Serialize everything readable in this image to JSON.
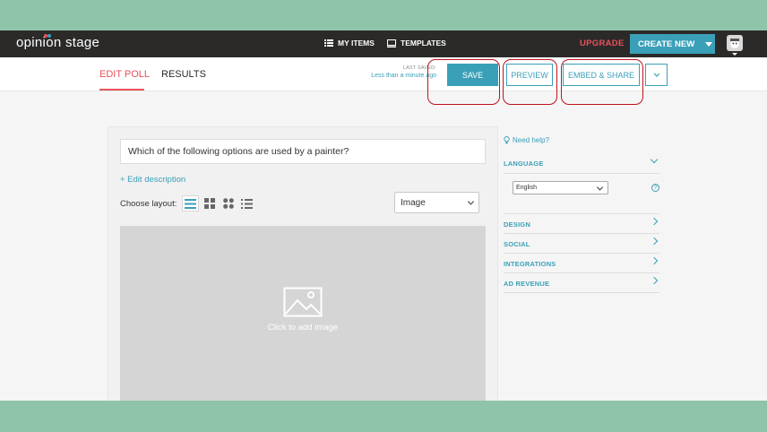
{
  "app": {
    "logo": "opinion stage"
  },
  "topnav": {
    "my_items": "MY ITEMS",
    "templates": "TEMPLATES",
    "upgrade": "UPGRADE",
    "create_new": "CREATE NEW"
  },
  "subheader": {
    "tabs": [
      {
        "label": "EDIT POLL",
        "active": true
      },
      {
        "label": "RESULTS",
        "active": false
      }
    ],
    "last_saved_label": "LAST SAVED:",
    "last_saved_value": "Less than a minute ago",
    "save": "SAVE",
    "preview": "PREVIEW",
    "embed_share": "EMBED & SHARE"
  },
  "editor": {
    "question": "Which of the following options are used by a painter?",
    "edit_description": "+ Edit description",
    "choose_layout": "Choose layout:",
    "layout_icons": [
      "list-layout-icon",
      "grid-layout-icon",
      "circles-layout-icon",
      "bullet-list-layout-icon"
    ],
    "media_type": "Image",
    "image_cta": "Click to add image"
  },
  "sidebar": {
    "help": "Need help?",
    "language": {
      "title": "LANGUAGE",
      "selected": "English"
    },
    "sections": [
      "DESIGN",
      "SOCIAL",
      "INTEGRATIONS",
      "AD REVENUE"
    ]
  },
  "colors": {
    "accent": "#3aa0b8",
    "brand_red": "#e8525a",
    "nav_bg": "#2b2a29",
    "backdrop": "#8fc4ab",
    "highlight": "#c0121b"
  }
}
